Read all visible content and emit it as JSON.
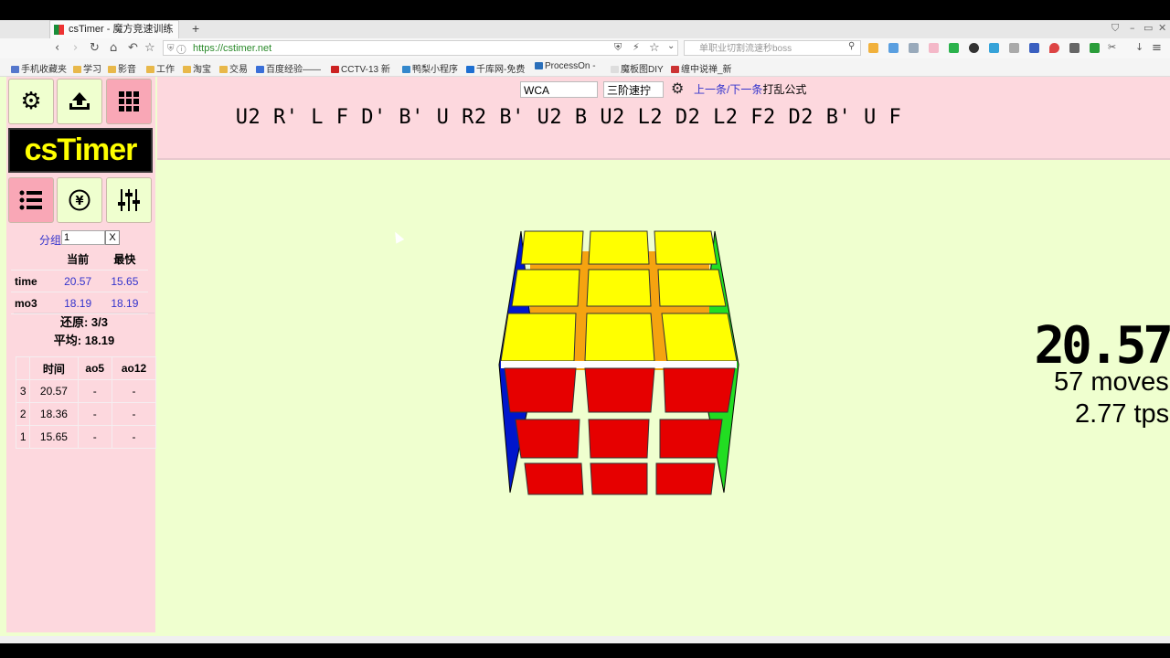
{
  "browser": {
    "tab_title": "csTimer - 魔方竞速训练",
    "new_tab": "+",
    "url": "https://cstimer.net",
    "search_placeholder": "单职业切割流速秒boss",
    "bookmarks": [
      "手机收藏夹",
      "学习",
      "影音",
      "工作",
      "淘宝",
      "交易",
      "百度经验——",
      "CCTV-13 新",
      "鸭梨小程序",
      "千库网-免费",
      "ProcessOn -",
      "魔板图DIY",
      "缠中说禅_新"
    ]
  },
  "app": {
    "logo": "csTimer",
    "group_label": "分组",
    "group_value": "1",
    "group_clear": "X",
    "scramble_type": "WCA",
    "puzzle": "三阶速拧",
    "prev_label": "上一条",
    "slash": "/",
    "next_label": "下一条",
    "scramble_suffix": "打乱公式",
    "scramble": "U2 R' L F D' B' U R2 B' U2 B U2 L2 D2 L2 F2 D2 B' U F"
  },
  "stats": {
    "col_current": "当前",
    "col_best": "最快",
    "rows": [
      {
        "label": "time",
        "current": "20.57",
        "best": "15.65"
      },
      {
        "label": "mo3",
        "current": "18.19",
        "best": "18.19"
      }
    ],
    "solved": "还原: 3/3",
    "mean": "平均: 18.19"
  },
  "times": {
    "headers": [
      "",
      "时间",
      "ao5",
      "ao12"
    ],
    "rows": [
      {
        "n": "3",
        "time": "20.57",
        "ao5": "-",
        "ao12": "-"
      },
      {
        "n": "2",
        "time": "18.36",
        "ao5": "-",
        "ao12": "-"
      },
      {
        "n": "1",
        "time": "15.65",
        "ao5": "-",
        "ao12": "-"
      }
    ]
  },
  "timer": {
    "display": "20.57",
    "moves": "57 moves",
    "tps": "2.77 tps"
  },
  "colors": {
    "page_bg": "#efffcf",
    "panel_bg": "#fdd8de",
    "accent": "#f9a7b6",
    "link": "#3333cc",
    "logo_text": "#ffff00"
  }
}
